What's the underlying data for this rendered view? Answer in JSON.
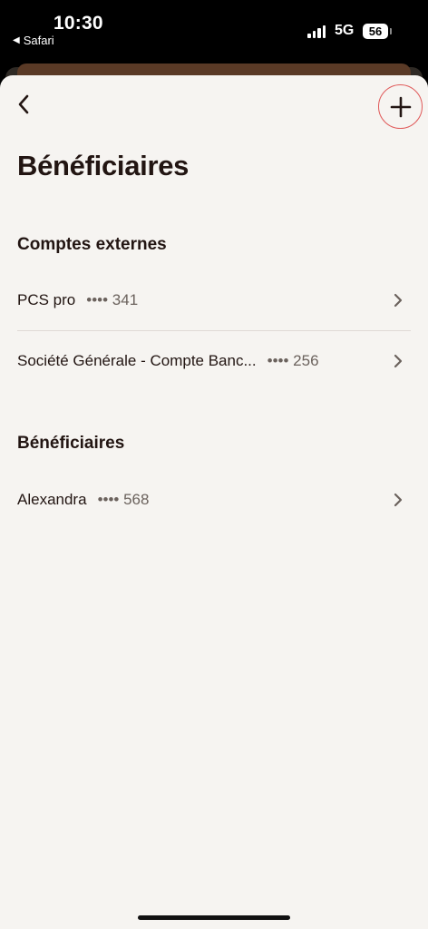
{
  "status_bar": {
    "time": "10:30",
    "back_app": "Safari",
    "network": "5G",
    "battery": "56"
  },
  "nav": {
    "back_icon": "chevron-left-icon",
    "add_icon": "plus-icon",
    "add_ring_color": "#e05a5a"
  },
  "page_title": "Bénéficiaires",
  "sections": [
    {
      "title": "Comptes externes",
      "items": [
        {
          "name": "PCS pro",
          "mask": "•••• 341"
        },
        {
          "name": "Société Générale - Compte Banc...",
          "mask": "•••• 256"
        }
      ]
    },
    {
      "title": "Bénéficiaires",
      "items": [
        {
          "name": "Alexandra",
          "mask": "•••• 568"
        }
      ]
    }
  ],
  "colors": {
    "background": "#f6f4f1",
    "text": "#221512",
    "muted": "#6b625d"
  }
}
